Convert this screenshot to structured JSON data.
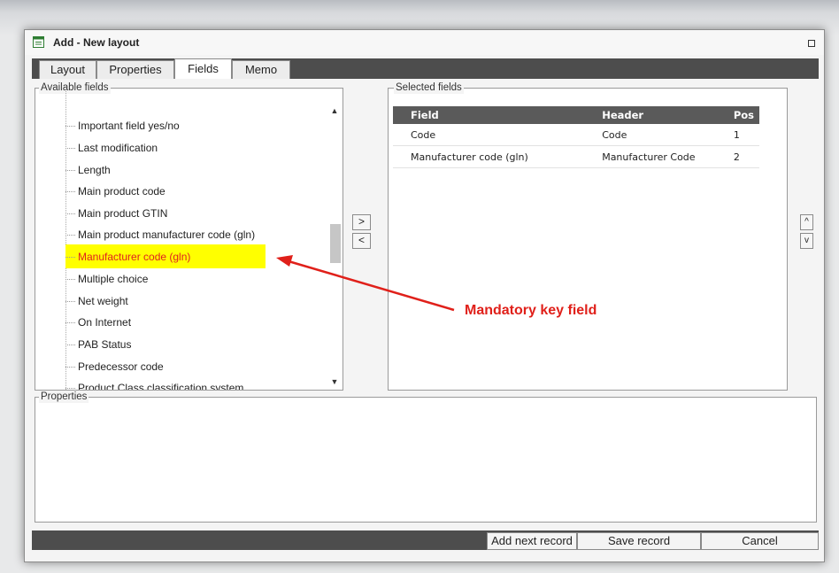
{
  "window": {
    "title": "Add - New layout"
  },
  "tabs": [
    {
      "label": "Layout",
      "active": false
    },
    {
      "label": "Properties",
      "active": false
    },
    {
      "label": "Fields",
      "active": true
    },
    {
      "label": "Memo",
      "active": false
    }
  ],
  "available_fields": {
    "legend": "Available fields",
    "items": [
      "Important field yes/no",
      "Last modification",
      "Length",
      "Main product code",
      "Main product GTIN",
      "Main product manufacturer code (gln)",
      "Manufacturer code (gln)",
      "Multiple choice",
      "Net weight",
      "On Internet",
      "PAB Status",
      "Predecessor code",
      "Product Class classification system"
    ],
    "selected_item": "Manufacturer code (gln)"
  },
  "move_buttons": {
    "add": ">",
    "remove": "<",
    "up": "^",
    "down": "v"
  },
  "selected_fields": {
    "legend": "Selected fields",
    "columns": [
      "Field",
      "Header",
      "Pos"
    ],
    "rows": [
      [
        "Code",
        "Code",
        "1"
      ],
      [
        "Manufacturer code (gln)",
        "Manufacturer Code",
        "2"
      ]
    ]
  },
  "properties": {
    "legend": "Properties"
  },
  "buttons": {
    "add_next": "Add next record",
    "save": "Save record",
    "cancel": "Cancel"
  },
  "annotation": {
    "text": "Mandatory key field",
    "color": "#e0201a"
  },
  "icons": {
    "window": "form-icon",
    "maximize": "maximize-icon"
  }
}
